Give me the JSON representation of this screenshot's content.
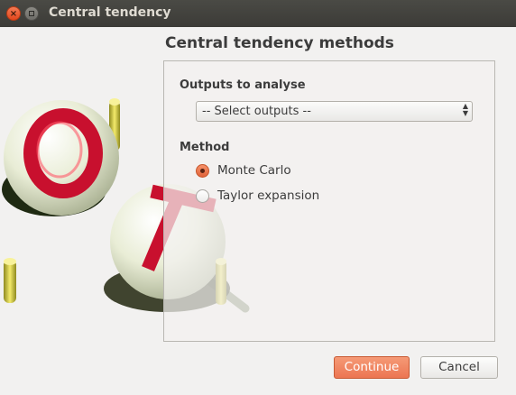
{
  "window": {
    "title": "Central tendency",
    "close_glyph": "×"
  },
  "page": {
    "heading": "Central tendency methods"
  },
  "outputs": {
    "label": "Outputs to analyse",
    "selected": "-- Select outputs --"
  },
  "method": {
    "label": "Method",
    "options": [
      {
        "label": "Monte Carlo",
        "checked": true
      },
      {
        "label": "Taylor expansion",
        "checked": false
      }
    ]
  },
  "buttons": {
    "continue": "Continue",
    "cancel": "Cancel"
  },
  "colors": {
    "accent": "#ec7552",
    "titlebar": "#3c3b37",
    "background": "#f2f1f0",
    "logo_red": "#c8102e"
  },
  "icons": [
    "close-icon",
    "minimize-icon",
    "dropdown-arrows-icon",
    "openturns-logo"
  ]
}
